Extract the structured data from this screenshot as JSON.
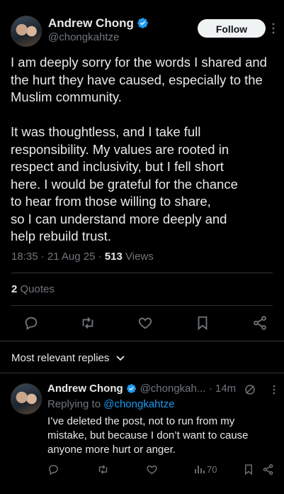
{
  "post": {
    "author_name": "Andrew Chong",
    "author_handle": "@chongkahtze",
    "follow_label": "Follow",
    "body": "I am deeply sorry for the words I shared and\nthe hurt they have caused, especially to the\nMuslim community.\n\nIt was thoughtless, and I take full\nresponsibility. My values are rooted in\nrespect and inclusivity, but I fell short\nhere. I would be grateful for the chance\nto hear from those willing to share,\nso I can understand more deeply and\nhelp rebuild trust.",
    "time": "18:35",
    "date": "21 Aug 25",
    "views_count": "513",
    "views_label": "Views",
    "quotes_count": "2",
    "quotes_label": "Quotes"
  },
  "replies_header": {
    "label": "Most relevant replies"
  },
  "reply": {
    "author_name": "Andrew Chong",
    "author_handle": "@chongkah...",
    "age": "14m",
    "replying_prefix": "Replying to",
    "replying_handle": "@chongkahtze",
    "body": "I’ve deleted the post, not to run from my\nmistake, but because I don’t want to cause\nanyone more hurt or anger.",
    "views": "70"
  },
  "colors": {
    "background": "#000000",
    "text": "#e7e9ea",
    "secondary": "#71767b",
    "accent": "#1d9bf0",
    "divider": "#2f3336"
  },
  "icons": [
    "verified-badge-icon",
    "more-icon",
    "reply-icon",
    "retweet-icon",
    "like-icon",
    "bookmark-icon",
    "share-icon",
    "chevron-down-icon",
    "edited-icon",
    "views-icon"
  ]
}
